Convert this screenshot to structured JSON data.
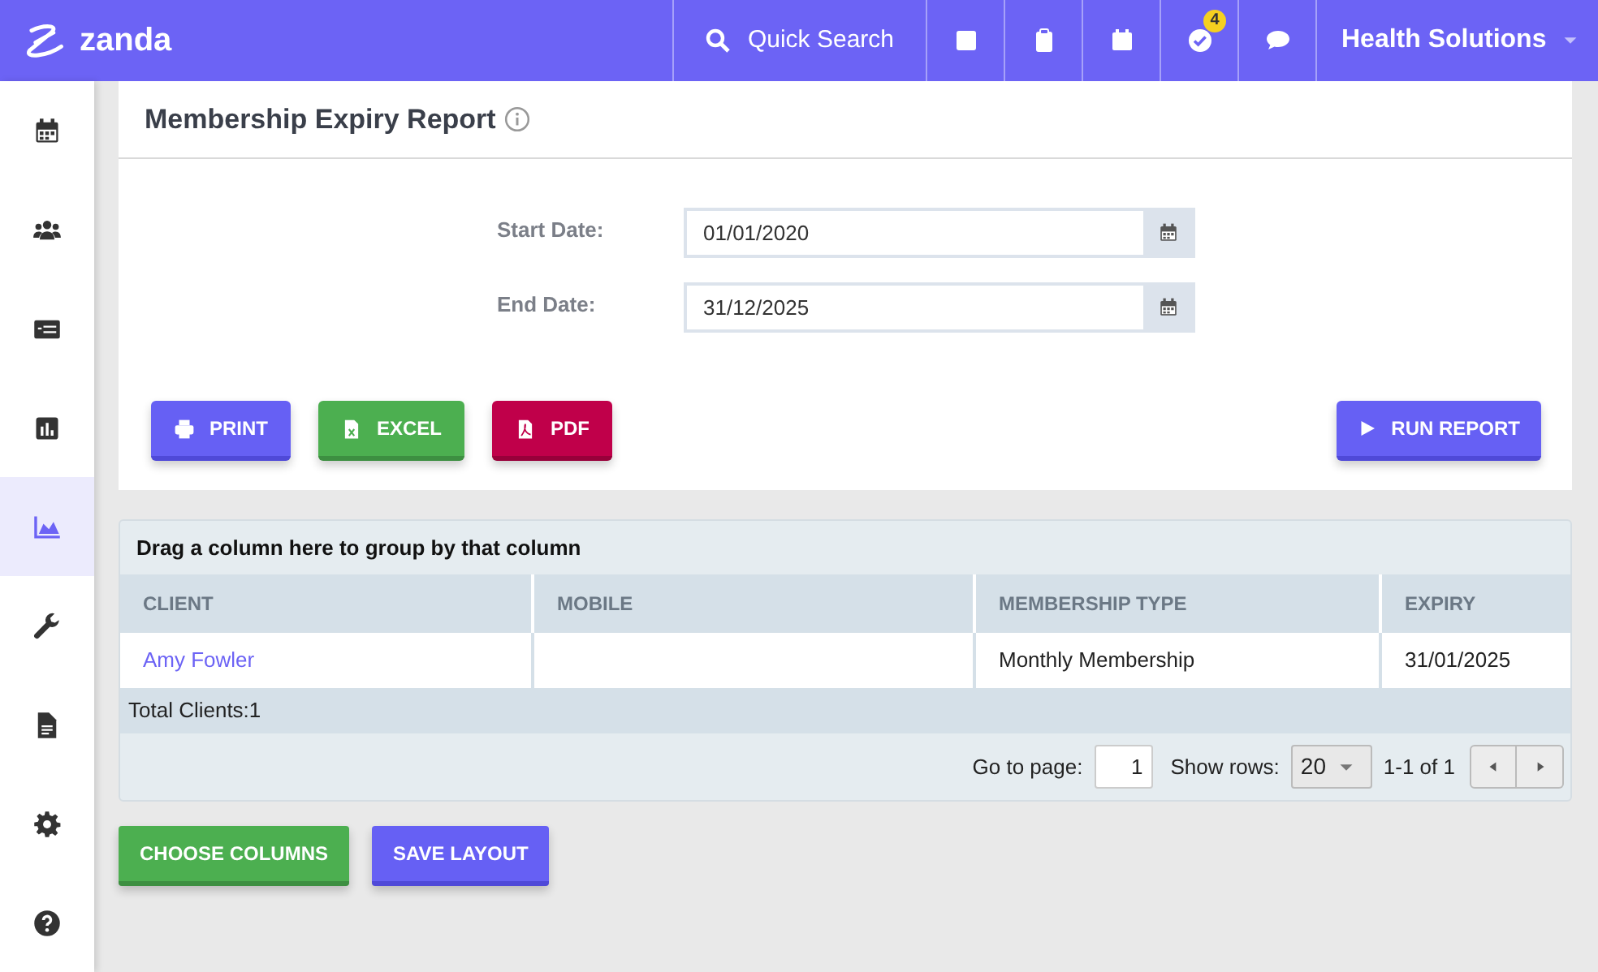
{
  "topbar": {
    "logo": "zanda",
    "search": "Quick Search",
    "badge": "4",
    "account": "Health Solutions"
  },
  "sidebar": {
    "items": [
      {
        "selected": false
      },
      {
        "selected": false
      },
      {
        "selected": false
      },
      {
        "selected": false
      },
      {
        "selected": true
      },
      {
        "selected": false
      },
      {
        "selected": false
      },
      {
        "selected": false
      },
      {
        "selected": false
      }
    ]
  },
  "report": {
    "title": "Membership Expiry Report",
    "fields": [
      {
        "label": "Start Date:",
        "value": "01/01/2020"
      },
      {
        "label": "End Date:",
        "value": "31/12/2025"
      }
    ],
    "buttons": [
      {
        "label": "PRINT",
        "kind": "print"
      },
      {
        "label": "EXCEL",
        "kind": "excel"
      },
      {
        "label": "PDF",
        "kind": "pdf"
      }
    ],
    "run_button": "RUN REPORT"
  },
  "grid": {
    "group_hint": "Drag a column here to group by that column",
    "columns": [
      "CLIENT",
      "MOBILE",
      "MEMBERSHIP TYPE",
      "EXPIRY"
    ],
    "rows": [
      [
        "Amy Fowler",
        "",
        "Monthly Membership",
        "31/01/2025"
      ]
    ],
    "total": "Total Clients:1",
    "pager": {
      "goto_label": "Go to page:",
      "page": "1",
      "rows_label": "Show rows:",
      "rows": "20",
      "range": "1-1 of 1"
    }
  },
  "footer_buttons": [
    "CHOOSE COLUMNS",
    "SAVE LAYOUT"
  ]
}
